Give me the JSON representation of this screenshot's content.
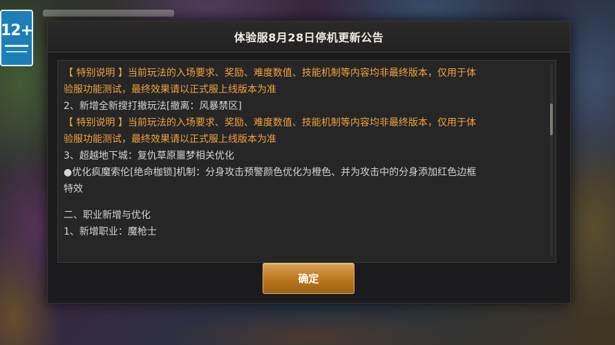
{
  "rating_badge": {
    "label": "12+"
  },
  "dialog": {
    "title": "体验服8月28日停机更新公告",
    "lines": [
      {
        "text": "【 特别说明 】当前玩法的入场要求、奖励、难度数值、技能机制等内容均非最终版本，仅用于体",
        "style": "orange"
      },
      {
        "text": "验服功能测试，最终效果请以正式服上线版本为准",
        "style": "orange"
      },
      {
        "text": "2、新增全新搜打撤玩法[撤离：风暴禁区]",
        "style": "normal"
      },
      {
        "text": "【 特别说明 】当前玩法的入场要求、奖励、难度数值、技能机制等内容均非最终版本，仅用于体",
        "style": "orange"
      },
      {
        "text": "验服功能测试，最终效果请以正式服上线版本为准",
        "style": "orange"
      },
      {
        "text": "3、超越地下城：复仇草原噩梦相关优化",
        "style": "normal"
      },
      {
        "text": "●优化疯魔索伦[绝命枷锁]机制：分身攻击预警颜色优化为橙色、并为攻击中的分身添加红色边框",
        "style": "normal"
      },
      {
        "text": "特效",
        "style": "normal"
      },
      {
        "text": "",
        "style": "gap"
      },
      {
        "text": "二、职业新增与优化",
        "style": "normal"
      },
      {
        "text": "1、新增职业：魔枪士",
        "style": "normal"
      }
    ],
    "confirm_label": "确定"
  },
  "colors": {
    "notice_orange": "#f2a33a",
    "body_text": "#d7d4cf",
    "button_gold": "#c07c24"
  }
}
